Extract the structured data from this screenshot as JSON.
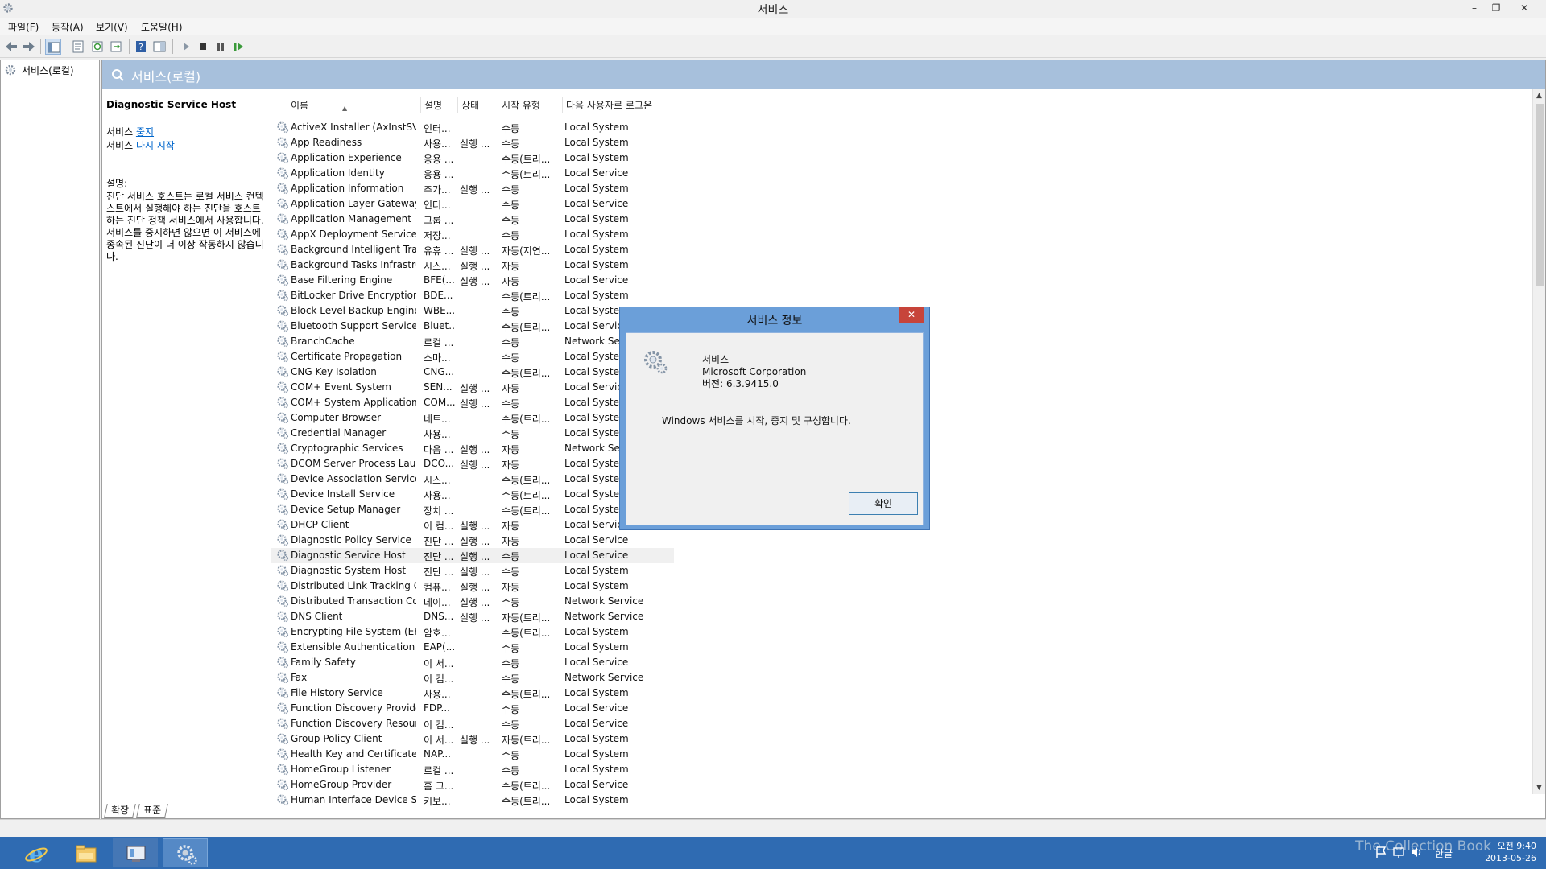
{
  "window": {
    "title": "서비스",
    "minimize": "–",
    "restore": "❐",
    "close": "✕"
  },
  "menu": [
    "파일(F)",
    "동작(A)",
    "보기(V)",
    "도움말(H)"
  ],
  "tree": {
    "root_label": "서비스(로컬)"
  },
  "header": {
    "title": "서비스(로컬)"
  },
  "details": {
    "service_name": "Diagnostic Service Host",
    "stop_prefix": "서비스 ",
    "stop_link": "중지",
    "restart_prefix": "서비스 ",
    "restart_link": "다시 시작",
    "description_label": "설명:",
    "description_text": "진단 서비스 호스트는 로컬 서비스 컨텍스트에서 실행해야 하는 진단을 호스트하는 진단 정책 서비스에서 사용합니다. 서비스를 중지하면 않으면 이 서비스에 종속된 진단이 더 이상 작동하지 않습니다."
  },
  "columns": {
    "name": "이름",
    "description": "설명",
    "status": "상태",
    "startup": "시작 유형",
    "logon": "다음 사용자로 로그온"
  },
  "services": [
    {
      "name": "ActiveX Installer (AxInstSV)",
      "desc": "인터...",
      "status": "",
      "startup": "수동",
      "logon": "Local System"
    },
    {
      "name": "App Readiness",
      "desc": "사용...",
      "status": "실행 ...",
      "startup": "수동",
      "logon": "Local System"
    },
    {
      "name": "Application Experience",
      "desc": "응용 ...",
      "status": "",
      "startup": "수동(트리...",
      "logon": "Local System"
    },
    {
      "name": "Application Identity",
      "desc": "응용 ...",
      "status": "",
      "startup": "수동(트리...",
      "logon": "Local Service"
    },
    {
      "name": "Application Information",
      "desc": "추가...",
      "status": "실행 ...",
      "startup": "수동",
      "logon": "Local System"
    },
    {
      "name": "Application Layer Gateway ...",
      "desc": "인터...",
      "status": "",
      "startup": "수동",
      "logon": "Local Service"
    },
    {
      "name": "Application Management",
      "desc": "그룹 ...",
      "status": "",
      "startup": "수동",
      "logon": "Local System"
    },
    {
      "name": "AppX Deployment Service ...",
      "desc": "저장...",
      "status": "",
      "startup": "수동",
      "logon": "Local System"
    },
    {
      "name": "Background Intelligent Tra...",
      "desc": "유휴 ...",
      "status": "실행 ...",
      "startup": "자동(지연...",
      "logon": "Local System"
    },
    {
      "name": "Background Tasks Infrastru...",
      "desc": "시스...",
      "status": "실행 ...",
      "startup": "자동",
      "logon": "Local System"
    },
    {
      "name": "Base Filtering Engine",
      "desc": "BFE(...",
      "status": "실행 ...",
      "startup": "자동",
      "logon": "Local Service"
    },
    {
      "name": "BitLocker Drive Encryption ...",
      "desc": "BDE...",
      "status": "",
      "startup": "수동(트리...",
      "logon": "Local System"
    },
    {
      "name": "Block Level Backup Engine ...",
      "desc": "WBE...",
      "status": "",
      "startup": "수동",
      "logon": "Local System"
    },
    {
      "name": "Bluetooth Support Service",
      "desc": "Bluet...",
      "status": "",
      "startup": "수동(트리...",
      "logon": "Local Service"
    },
    {
      "name": "BranchCache",
      "desc": "로컬 ...",
      "status": "",
      "startup": "수동",
      "logon": "Network Service"
    },
    {
      "name": "Certificate Propagation",
      "desc": "스마...",
      "status": "",
      "startup": "수동",
      "logon": "Local System"
    },
    {
      "name": "CNG Key Isolation",
      "desc": "CNG...",
      "status": "",
      "startup": "수동(트리...",
      "logon": "Local System"
    },
    {
      "name": "COM+ Event System",
      "desc": "SEN...",
      "status": "실행 ...",
      "startup": "자동",
      "logon": "Local Service"
    },
    {
      "name": "COM+ System Application",
      "desc": "COM...",
      "status": "실행 ...",
      "startup": "수동",
      "logon": "Local System"
    },
    {
      "name": "Computer Browser",
      "desc": "네트...",
      "status": "",
      "startup": "수동(트리...",
      "logon": "Local System"
    },
    {
      "name": "Credential Manager",
      "desc": "사용...",
      "status": "",
      "startup": "수동",
      "logon": "Local System"
    },
    {
      "name": "Cryptographic Services",
      "desc": "다음 ...",
      "status": "실행 ...",
      "startup": "자동",
      "logon": "Network Service"
    },
    {
      "name": "DCOM Server Process Lau...",
      "desc": "DCO...",
      "status": "실행 ...",
      "startup": "자동",
      "logon": "Local System"
    },
    {
      "name": "Device Association Service",
      "desc": "시스...",
      "status": "",
      "startup": "수동(트리...",
      "logon": "Local System"
    },
    {
      "name": "Device Install Service",
      "desc": "사용...",
      "status": "",
      "startup": "수동(트리...",
      "logon": "Local System"
    },
    {
      "name": "Device Setup Manager",
      "desc": "장치 ...",
      "status": "",
      "startup": "수동(트리...",
      "logon": "Local System"
    },
    {
      "name": "DHCP Client",
      "desc": "이 컴...",
      "status": "실행 ...",
      "startup": "자동",
      "logon": "Local Service"
    },
    {
      "name": "Diagnostic Policy Service",
      "desc": "진단 ...",
      "status": "실행 ...",
      "startup": "자동",
      "logon": "Local Service"
    },
    {
      "name": "Diagnostic Service Host",
      "desc": "진단 ...",
      "status": "실행 ...",
      "startup": "수동",
      "logon": "Local Service"
    },
    {
      "name": "Diagnostic System Host",
      "desc": "진단 ...",
      "status": "실행 ...",
      "startup": "수동",
      "logon": "Local System"
    },
    {
      "name": "Distributed Link Tracking C...",
      "desc": "컴퓨...",
      "status": "실행 ...",
      "startup": "자동",
      "logon": "Local System"
    },
    {
      "name": "Distributed Transaction Co...",
      "desc": "데이...",
      "status": "실행 ...",
      "startup": "수동",
      "logon": "Network Service"
    },
    {
      "name": "DNS Client",
      "desc": "DNS...",
      "status": "실행 ...",
      "startup": "자동(트리...",
      "logon": "Network Service"
    },
    {
      "name": "Encrypting File System (EFS)",
      "desc": "암호...",
      "status": "",
      "startup": "수동(트리...",
      "logon": "Local System"
    },
    {
      "name": "Extensible Authentication P...",
      "desc": "EAP(...",
      "status": "",
      "startup": "수동",
      "logon": "Local System"
    },
    {
      "name": "Family Safety",
      "desc": "이 서...",
      "status": "",
      "startup": "수동",
      "logon": "Local Service"
    },
    {
      "name": "Fax",
      "desc": "이 컴...",
      "status": "",
      "startup": "수동",
      "logon": "Network Service"
    },
    {
      "name": "File History Service",
      "desc": "사용...",
      "status": "",
      "startup": "수동(트리...",
      "logon": "Local System"
    },
    {
      "name": "Function Discovery Provide...",
      "desc": "FDP...",
      "status": "",
      "startup": "수동",
      "logon": "Local Service"
    },
    {
      "name": "Function Discovery Resour...",
      "desc": "이 컴...",
      "status": "",
      "startup": "수동",
      "logon": "Local Service"
    },
    {
      "name": "Group Policy Client",
      "desc": "이 서...",
      "status": "실행 ...",
      "startup": "자동(트리...",
      "logon": "Local System"
    },
    {
      "name": "Health Key and Certificate ...",
      "desc": "NAP...",
      "status": "",
      "startup": "수동",
      "logon": "Local System"
    },
    {
      "name": "HomeGroup Listener",
      "desc": "로컬 ...",
      "status": "",
      "startup": "수동",
      "logon": "Local System"
    },
    {
      "name": "HomeGroup Provider",
      "desc": "홈 그...",
      "status": "",
      "startup": "수동(트리...",
      "logon": "Local Service"
    },
    {
      "name": "Human Interface Device Se...",
      "desc": "키보...",
      "status": "",
      "startup": "수동(트리...",
      "logon": "Local System"
    }
  ],
  "selected_index": 28,
  "tabs": [
    "확장",
    "표준"
  ],
  "dialog": {
    "title": "서비스 정보",
    "close": "✕",
    "product": "서비스",
    "company": "Microsoft Corporation",
    "version": "버전: 6.3.9415.0",
    "message": "Windows 서비스를 시작, 중지 및 구성합니다.",
    "ok": "확인"
  },
  "taskbar": {
    "items": [
      "internet-explorer",
      "file-explorer",
      "server-manager",
      "services"
    ],
    "ime": "한글",
    "time": "오전 9:40",
    "date": "2013-05-26",
    "watermark": "The Collection Book"
  },
  "colors": {
    "header_band": "#a7c0dc",
    "taskbar": "#2f6bb2",
    "dialog_frame": "#6b9fd9",
    "dialog_close": "#c7443a",
    "link": "#0066cc"
  }
}
